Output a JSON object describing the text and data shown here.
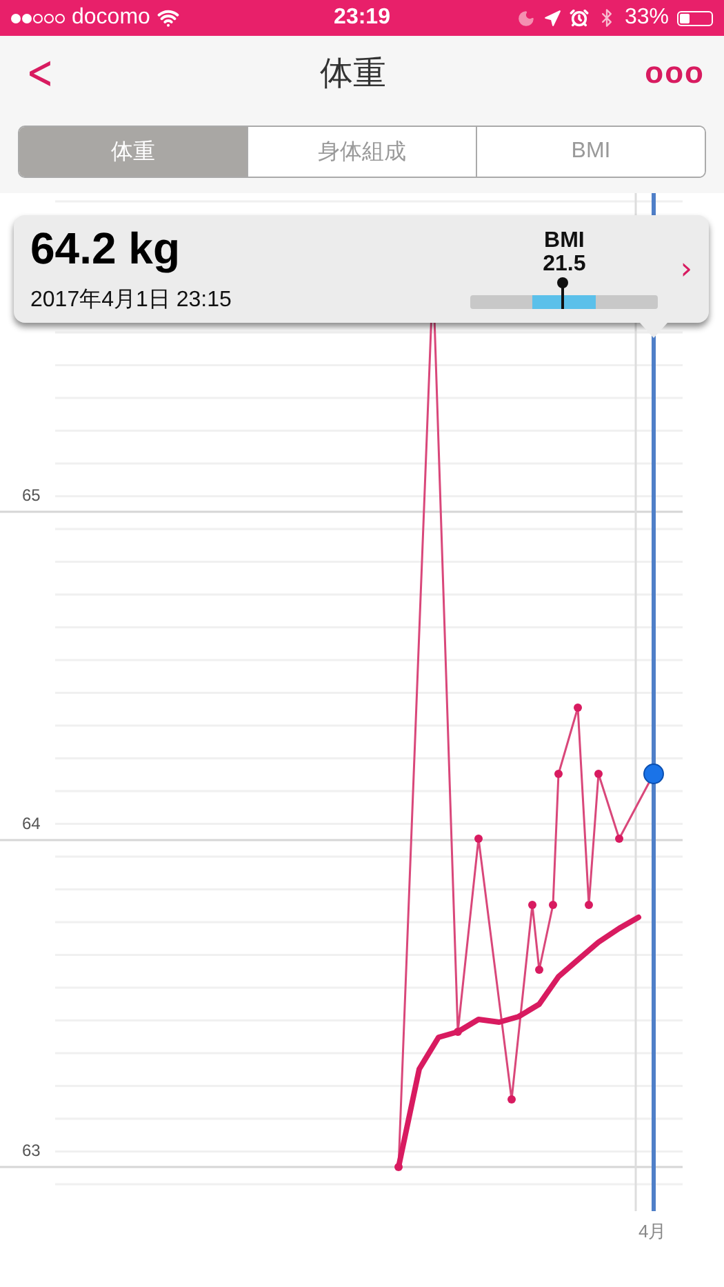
{
  "status_bar": {
    "carrier": "docomo",
    "time": "23:19",
    "battery": "33%"
  },
  "nav": {
    "back": "<",
    "title": "体重",
    "more": "ooo"
  },
  "tabs": [
    {
      "label": "体重",
      "selected": true
    },
    {
      "label": "身体組成",
      "selected": false
    },
    {
      "label": "BMI",
      "selected": false
    }
  ],
  "selection": {
    "weight": "64.2 kg",
    "datetime": "2017年4月1日 23:15",
    "bmi_label": "BMI",
    "bmi_value": "21.5",
    "bmi_meter": {
      "level": 0.49
    },
    "chevron": "›"
  },
  "chart": {
    "y_labels": [
      "65",
      "64",
      "63"
    ],
    "x_label": "4月"
  }
}
